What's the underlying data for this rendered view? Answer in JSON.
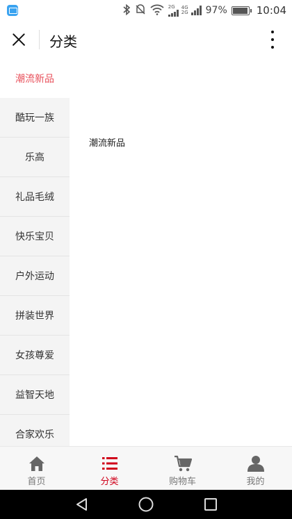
{
  "status_bar": {
    "network_top": "2G",
    "network_left_top": "4G",
    "network_left_bottom": "2G",
    "battery_percent": "97%",
    "battery_level": 0.97,
    "time": "10:04"
  },
  "header": {
    "title": "分类"
  },
  "sidebar": {
    "items": [
      {
        "label": "潮流新品",
        "active": true
      },
      {
        "label": "酷玩一族"
      },
      {
        "label": "乐高"
      },
      {
        "label": "礼品毛绒"
      },
      {
        "label": "快乐宝贝"
      },
      {
        "label": "户外运动"
      },
      {
        "label": "拼装世界"
      },
      {
        "label": "女孩尊爱"
      },
      {
        "label": "益智天地"
      },
      {
        "label": "合家欢乐"
      }
    ]
  },
  "content": {
    "heading": "潮流新品"
  },
  "tabbar": {
    "tabs": [
      {
        "label": "首页",
        "icon": "home-icon"
      },
      {
        "label": "分类",
        "icon": "category-list-icon",
        "active": true
      },
      {
        "label": "购物车",
        "icon": "cart-icon"
      },
      {
        "label": "我的",
        "icon": "user-icon"
      }
    ]
  },
  "colors": {
    "accent": "#d0021b",
    "sidebar_active_text": "#e8505b",
    "sidebar_bg": "#f4f4f4",
    "tabbar_bg": "#f7f7f7"
  }
}
